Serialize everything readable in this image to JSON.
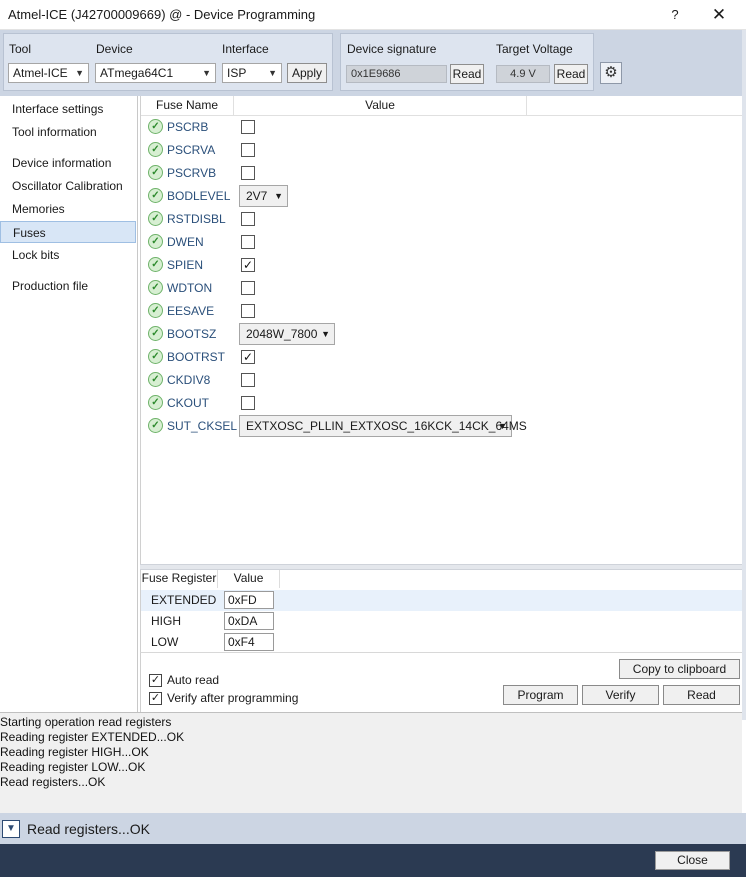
{
  "window": {
    "title": "Atmel-ICE (J42700009669) @  - Device Programming",
    "help": "?",
    "close": "✕"
  },
  "toolbar": {
    "tool_label": "Tool",
    "tool_value": "Atmel-ICE",
    "device_label": "Device",
    "device_value": "ATmega64C1",
    "interface_label": "Interface",
    "interface_value": "ISP",
    "apply": "Apply",
    "signature_label": "Device signature",
    "signature_value": "0x1E9686",
    "signature_read": "Read",
    "voltage_label": "Target Voltage",
    "voltage_value": "4.9 V",
    "voltage_read": "Read",
    "settings_icon": "gear-icon"
  },
  "sidebar": {
    "items": [
      {
        "label": "Interface settings"
      },
      {
        "label": "Tool information"
      },
      {
        "label": "Device information"
      },
      {
        "label": "Oscillator Calibration"
      },
      {
        "label": "Memories"
      },
      {
        "label": "Fuses"
      },
      {
        "label": "Lock bits"
      },
      {
        "label": "Production file"
      }
    ],
    "selected": "Fuses"
  },
  "fuses": {
    "col_name": "Fuse Name",
    "col_value": "Value",
    "rows": [
      {
        "name": "PSCRB",
        "type": "checkbox",
        "checked": false
      },
      {
        "name": "PSCRVA",
        "type": "checkbox",
        "checked": false
      },
      {
        "name": "PSCRVB",
        "type": "checkbox",
        "checked": false
      },
      {
        "name": "BODLEVEL",
        "type": "select",
        "value": "2V7"
      },
      {
        "name": "RSTDISBL",
        "type": "checkbox",
        "checked": false
      },
      {
        "name": "DWEN",
        "type": "checkbox",
        "checked": false
      },
      {
        "name": "SPIEN",
        "type": "checkbox",
        "checked": true
      },
      {
        "name": "WDTON",
        "type": "checkbox",
        "checked": false
      },
      {
        "name": "EESAVE",
        "type": "checkbox",
        "checked": false
      },
      {
        "name": "BOOTSZ",
        "type": "select",
        "value": "2048W_7800"
      },
      {
        "name": "BOOTRST",
        "type": "checkbox",
        "checked": true
      },
      {
        "name": "CKDIV8",
        "type": "checkbox",
        "checked": false
      },
      {
        "name": "CKOUT",
        "type": "checkbox",
        "checked": false
      },
      {
        "name": "SUT_CKSEL",
        "type": "select",
        "value": "EXTXOSC_PLLIN_EXTXOSC_16KCK_14CK_64MS"
      }
    ]
  },
  "registers": {
    "col_register": "Fuse Register",
    "col_value": "Value",
    "rows": [
      {
        "name": "EXTENDED",
        "value": "0xFD"
      },
      {
        "name": "HIGH",
        "value": "0xDA"
      },
      {
        "name": "LOW",
        "value": "0xF4"
      }
    ]
  },
  "options": {
    "auto_read": "Auto read",
    "auto_read_checked": true,
    "verify": "Verify after programming",
    "verify_checked": true,
    "copy": "Copy to clipboard",
    "program": "Program",
    "verify_btn": "Verify",
    "read": "Read"
  },
  "log": {
    "lines": [
      "Starting operation read registers",
      "Reading register EXTENDED...OK",
      "Reading register HIGH...OK",
      "Reading register LOW...OK",
      "Read registers...OK"
    ]
  },
  "status": {
    "text": "Read registers...OK"
  },
  "footer": {
    "close": "Close"
  }
}
